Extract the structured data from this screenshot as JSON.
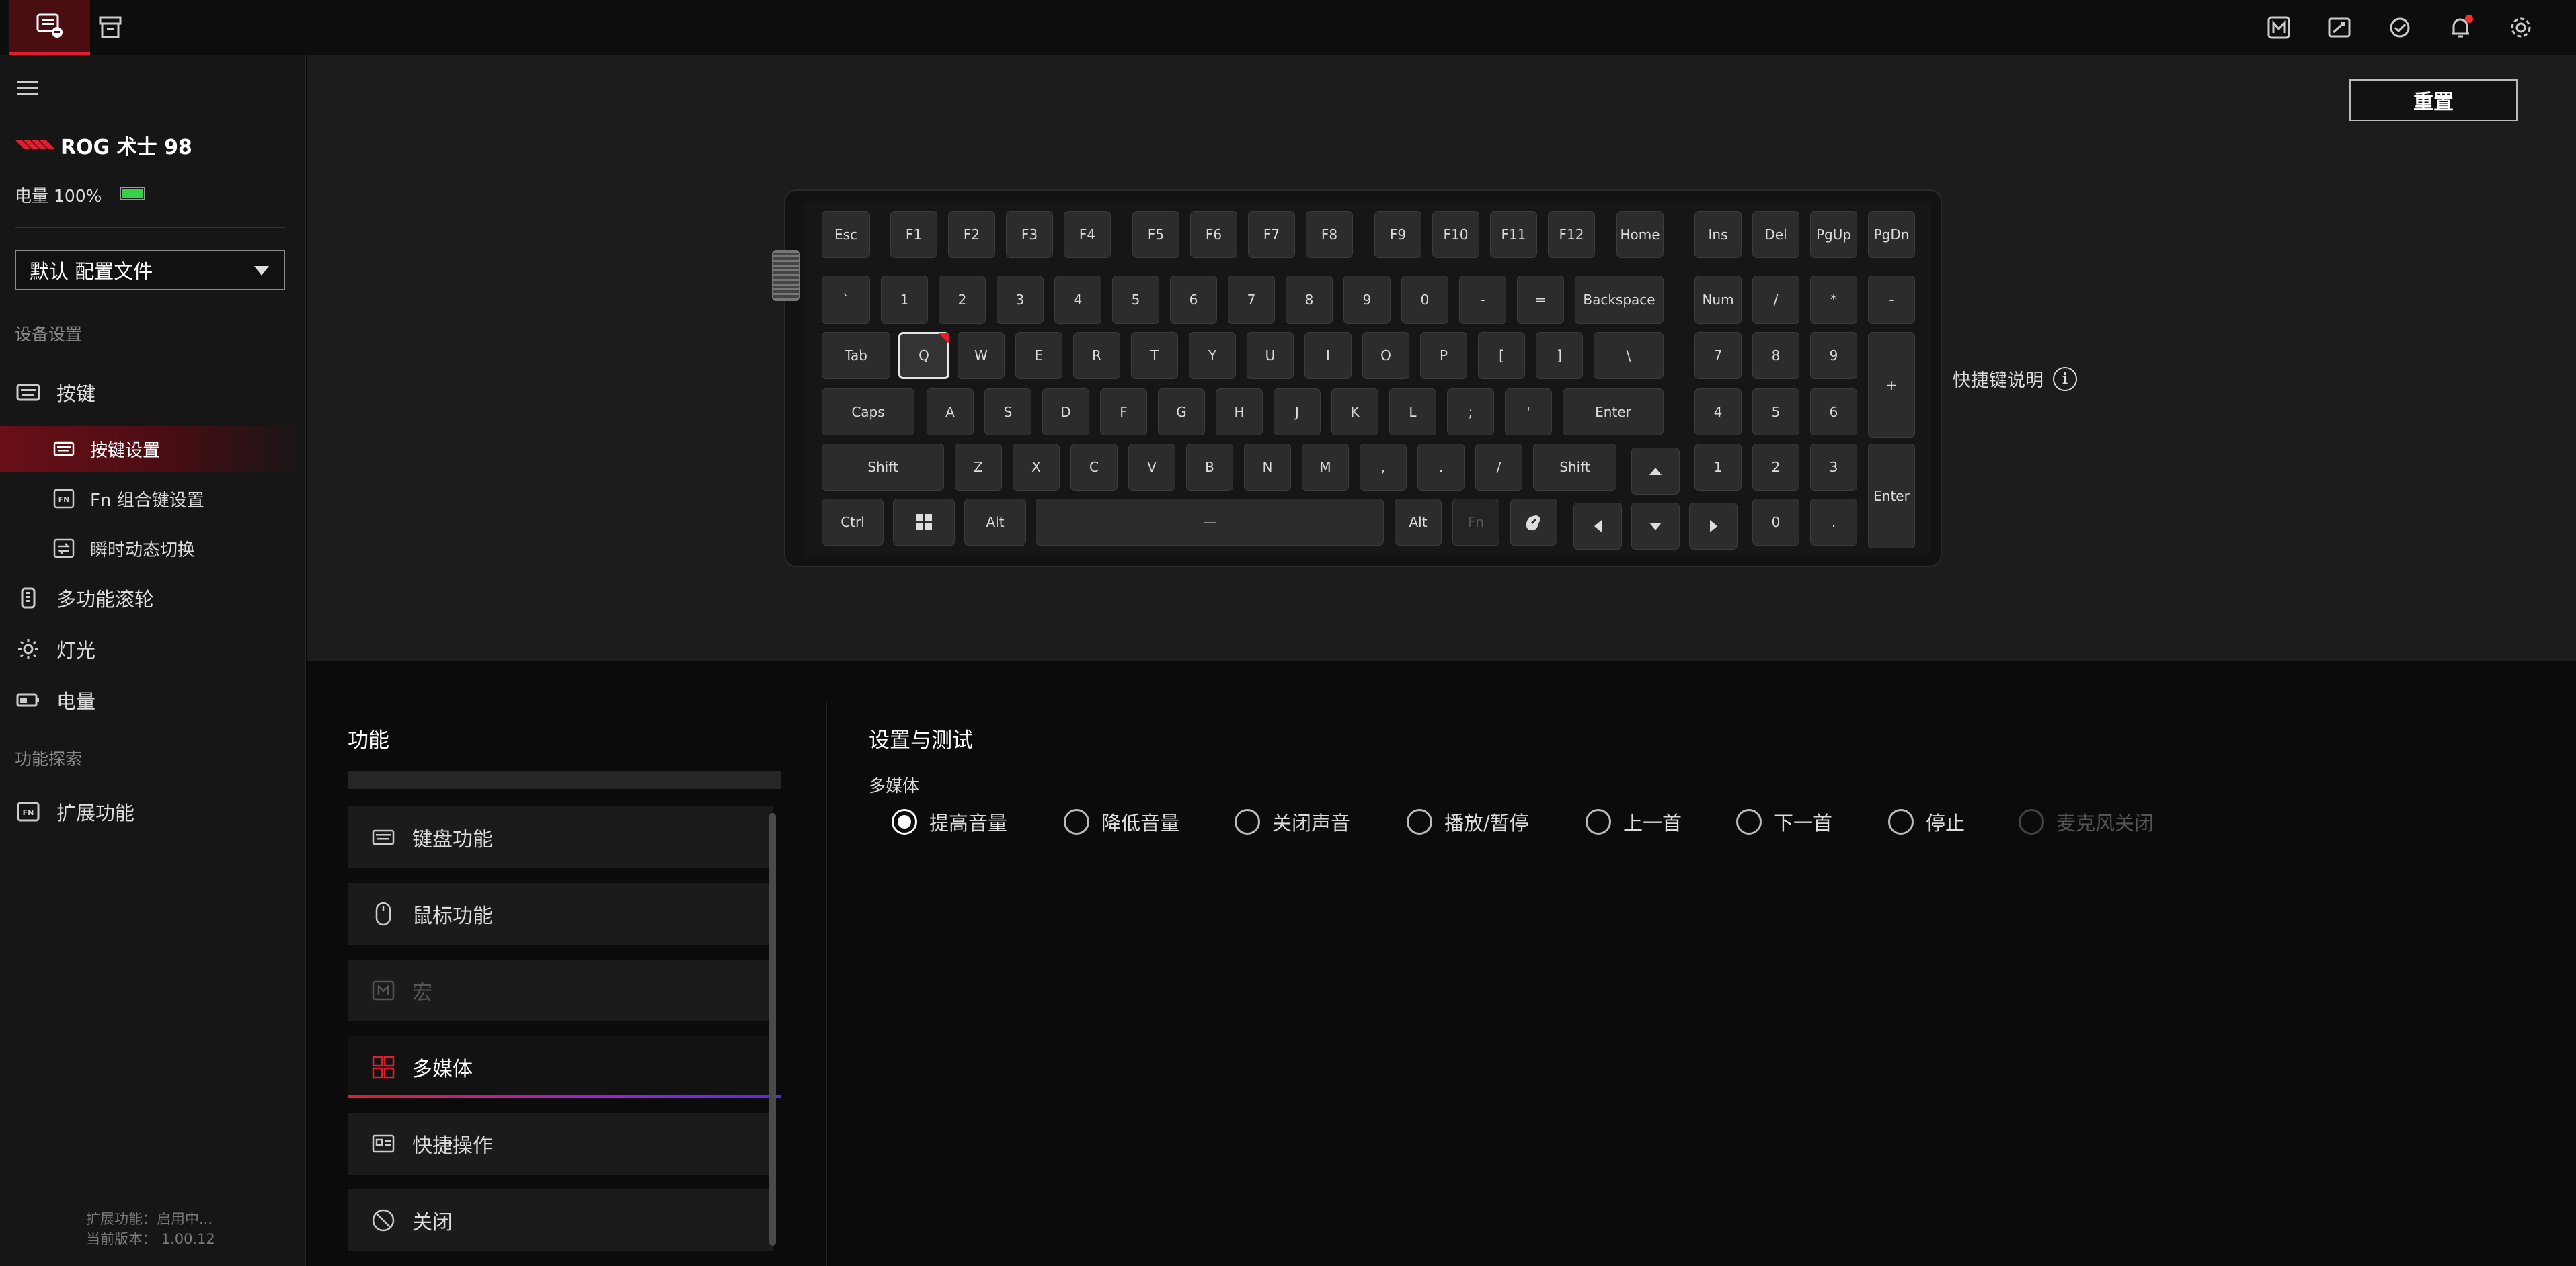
{
  "topbar": {
    "tabs": [
      {
        "name": "device-tab",
        "icon": "keyboard-device-icon",
        "active": true
      },
      {
        "name": "store-tab",
        "icon": "store-icon",
        "active": false
      }
    ],
    "right_icons": [
      "macro-icon",
      "edit-icon",
      "sync-icon",
      "bell-icon",
      "gear-icon"
    ]
  },
  "sidebar": {
    "device_name": "ROG 术士 98",
    "battery_label": "电量 100%",
    "battery_level": 100,
    "profile": "默认 配置文件",
    "section_device": "设备设置",
    "keys_label": "按键",
    "sub_items": [
      {
        "label": "按键设置",
        "active": true
      },
      {
        "label": "Fn 组合键设置",
        "active": false
      },
      {
        "label": "瞬时动态切换",
        "active": false
      }
    ],
    "wheel_label": "多功能滚轮",
    "light_label": "灯光",
    "power_label": "电量",
    "section_explore": "功能探索",
    "extension_label": "扩展功能",
    "footer_extension": "扩展功能：启用中...",
    "footer_version": "当前版本： 1.00.12"
  },
  "main": {
    "reset_label": "重置",
    "shortcut_help_label": "快捷键说明",
    "selected_key": "Q",
    "keys": {
      "esc": "Esc",
      "f1": "F1",
      "f2": "F2",
      "f3": "F3",
      "f4": "F4",
      "f5": "F5",
      "f6": "F6",
      "f7": "F7",
      "f8": "F8",
      "f9": "F9",
      "f10": "F10",
      "f11": "F11",
      "f12": "F12",
      "home": "Home",
      "ins": "Ins",
      "del": "Del",
      "pgup": "PgUp",
      "pgdn": "PgDn",
      "grave": "`",
      "d1": "1",
      "d2": "2",
      "d3": "3",
      "d4": "4",
      "d5": "5",
      "d6": "6",
      "d7": "7",
      "d8": "8",
      "d9": "9",
      "d0": "0",
      "minus": "-",
      "equal": "=",
      "backspace": "Backspace",
      "num": "Num",
      "np_slash": "/",
      "np_star": "*",
      "np_minus": "-",
      "tab": "Tab",
      "q": "Q",
      "w": "W",
      "e": "E",
      "r": "R",
      "t": "T",
      "y": "Y",
      "u": "U",
      "i": "I",
      "o": "O",
      "p": "P",
      "lbracket": "[",
      "rbracket": "]",
      "backslash": "\\",
      "np7": "7",
      "np8": "8",
      "np9": "9",
      "np_plus": "+",
      "caps": "Caps",
      "a": "A",
      "s": "S",
      "d": "D",
      "f": "F",
      "g": "G",
      "h": "H",
      "j": "J",
      "k": "K",
      "l": "L",
      "semicolon": ";",
      "quote": "'",
      "enter": "Enter",
      "np4": "4",
      "np5": "5",
      "np6": "6",
      "lshift": "Shift",
      "z": "Z",
      "x": "X",
      "c": "C",
      "v": "V",
      "b": "B",
      "n": "N",
      "m": "M",
      "comma": ",",
      "period": ".",
      "slash": "/",
      "rshift": "Shift",
      "np1": "1",
      "np2": "2",
      "np3": "3",
      "np_enter": "Enter",
      "ctrl": "Ctrl",
      "alt": "Alt",
      "space": "—",
      "ralt": "Alt",
      "fn": "Fn",
      "np0": "0",
      "np_dot": "."
    }
  },
  "functions": {
    "title": "功能",
    "items": [
      {
        "label": "键盘功能",
        "icon": "keyboard-icon",
        "state": "normal"
      },
      {
        "label": "鼠标功能",
        "icon": "mouse-icon",
        "state": "normal"
      },
      {
        "label": "宏",
        "icon": "macro-icon",
        "state": "disabled"
      },
      {
        "label": "多媒体",
        "icon": "multimedia-icon",
        "state": "active"
      },
      {
        "label": "快捷操作",
        "icon": "shortcut-icon",
        "state": "normal"
      },
      {
        "label": "关闭",
        "icon": "disable-icon",
        "state": "normal"
      }
    ]
  },
  "settings": {
    "title": "设置与测试",
    "group_label": "多媒体",
    "options": [
      {
        "label": "提高音量",
        "checked": true,
        "disabled": false
      },
      {
        "label": "降低音量",
        "checked": false,
        "disabled": false
      },
      {
        "label": "关闭声音",
        "checked": false,
        "disabled": false
      },
      {
        "label": "播放/暂停",
        "checked": false,
        "disabled": false
      },
      {
        "label": "上一首",
        "checked": false,
        "disabled": false
      },
      {
        "label": "下一首",
        "checked": false,
        "disabled": false
      },
      {
        "label": "停止",
        "checked": false,
        "disabled": false
      },
      {
        "label": "麦克风关闭",
        "checked": false,
        "disabled": true
      }
    ]
  },
  "colors": {
    "accent": "#e01e2d",
    "battery": "#3ad14a",
    "panel": "#1b1b1b",
    "background": "#0a0a0a"
  }
}
